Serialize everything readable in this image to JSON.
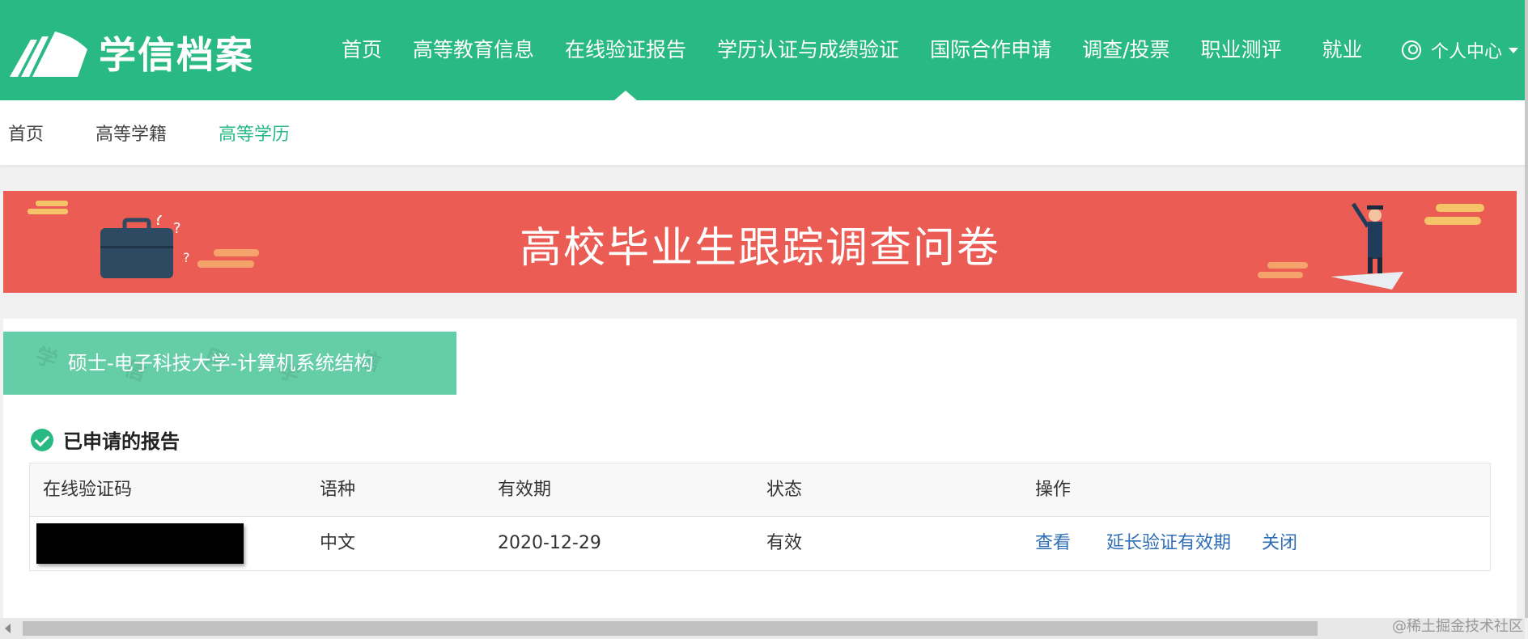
{
  "brand": {
    "name": "学信档案"
  },
  "nav": {
    "items": [
      {
        "label": "首页",
        "active": false
      },
      {
        "label": "高等教育信息",
        "active": false
      },
      {
        "label": "在线验证报告",
        "active": true
      },
      {
        "label": "学历认证与成绩验证",
        "active": false
      },
      {
        "label": "国际合作申请",
        "active": false
      },
      {
        "label": "调查/投票",
        "active": false
      },
      {
        "label": "职业测评",
        "active": false
      },
      {
        "label": "就业",
        "active": false
      }
    ],
    "user_center": "个人中心"
  },
  "subnav": {
    "items": [
      {
        "label": "首页",
        "active": false
      },
      {
        "label": "高等学籍",
        "active": false
      },
      {
        "label": "高等学历",
        "active": true
      }
    ]
  },
  "banner": {
    "title": "高校毕业生跟踪调查问卷"
  },
  "degree_tab": {
    "label": "硕士-电子科技大学-计算机系统结构"
  },
  "reports": {
    "title": "已申请的报告",
    "columns": [
      "在线验证码",
      "语种",
      "有效期",
      "状态",
      "操作"
    ],
    "rows": [
      {
        "code": "",
        "language": "中文",
        "expiry": "2020-12-29",
        "status": "有效",
        "actions": [
          "查看",
          "延长验证有效期",
          "关闭"
        ]
      }
    ]
  },
  "colors": {
    "primary": "#29b985",
    "banner": "#eb5c55",
    "link": "#2f6db5",
    "tab": "#65cda8"
  },
  "footer_watermark": "@稀土掘金技术社区"
}
